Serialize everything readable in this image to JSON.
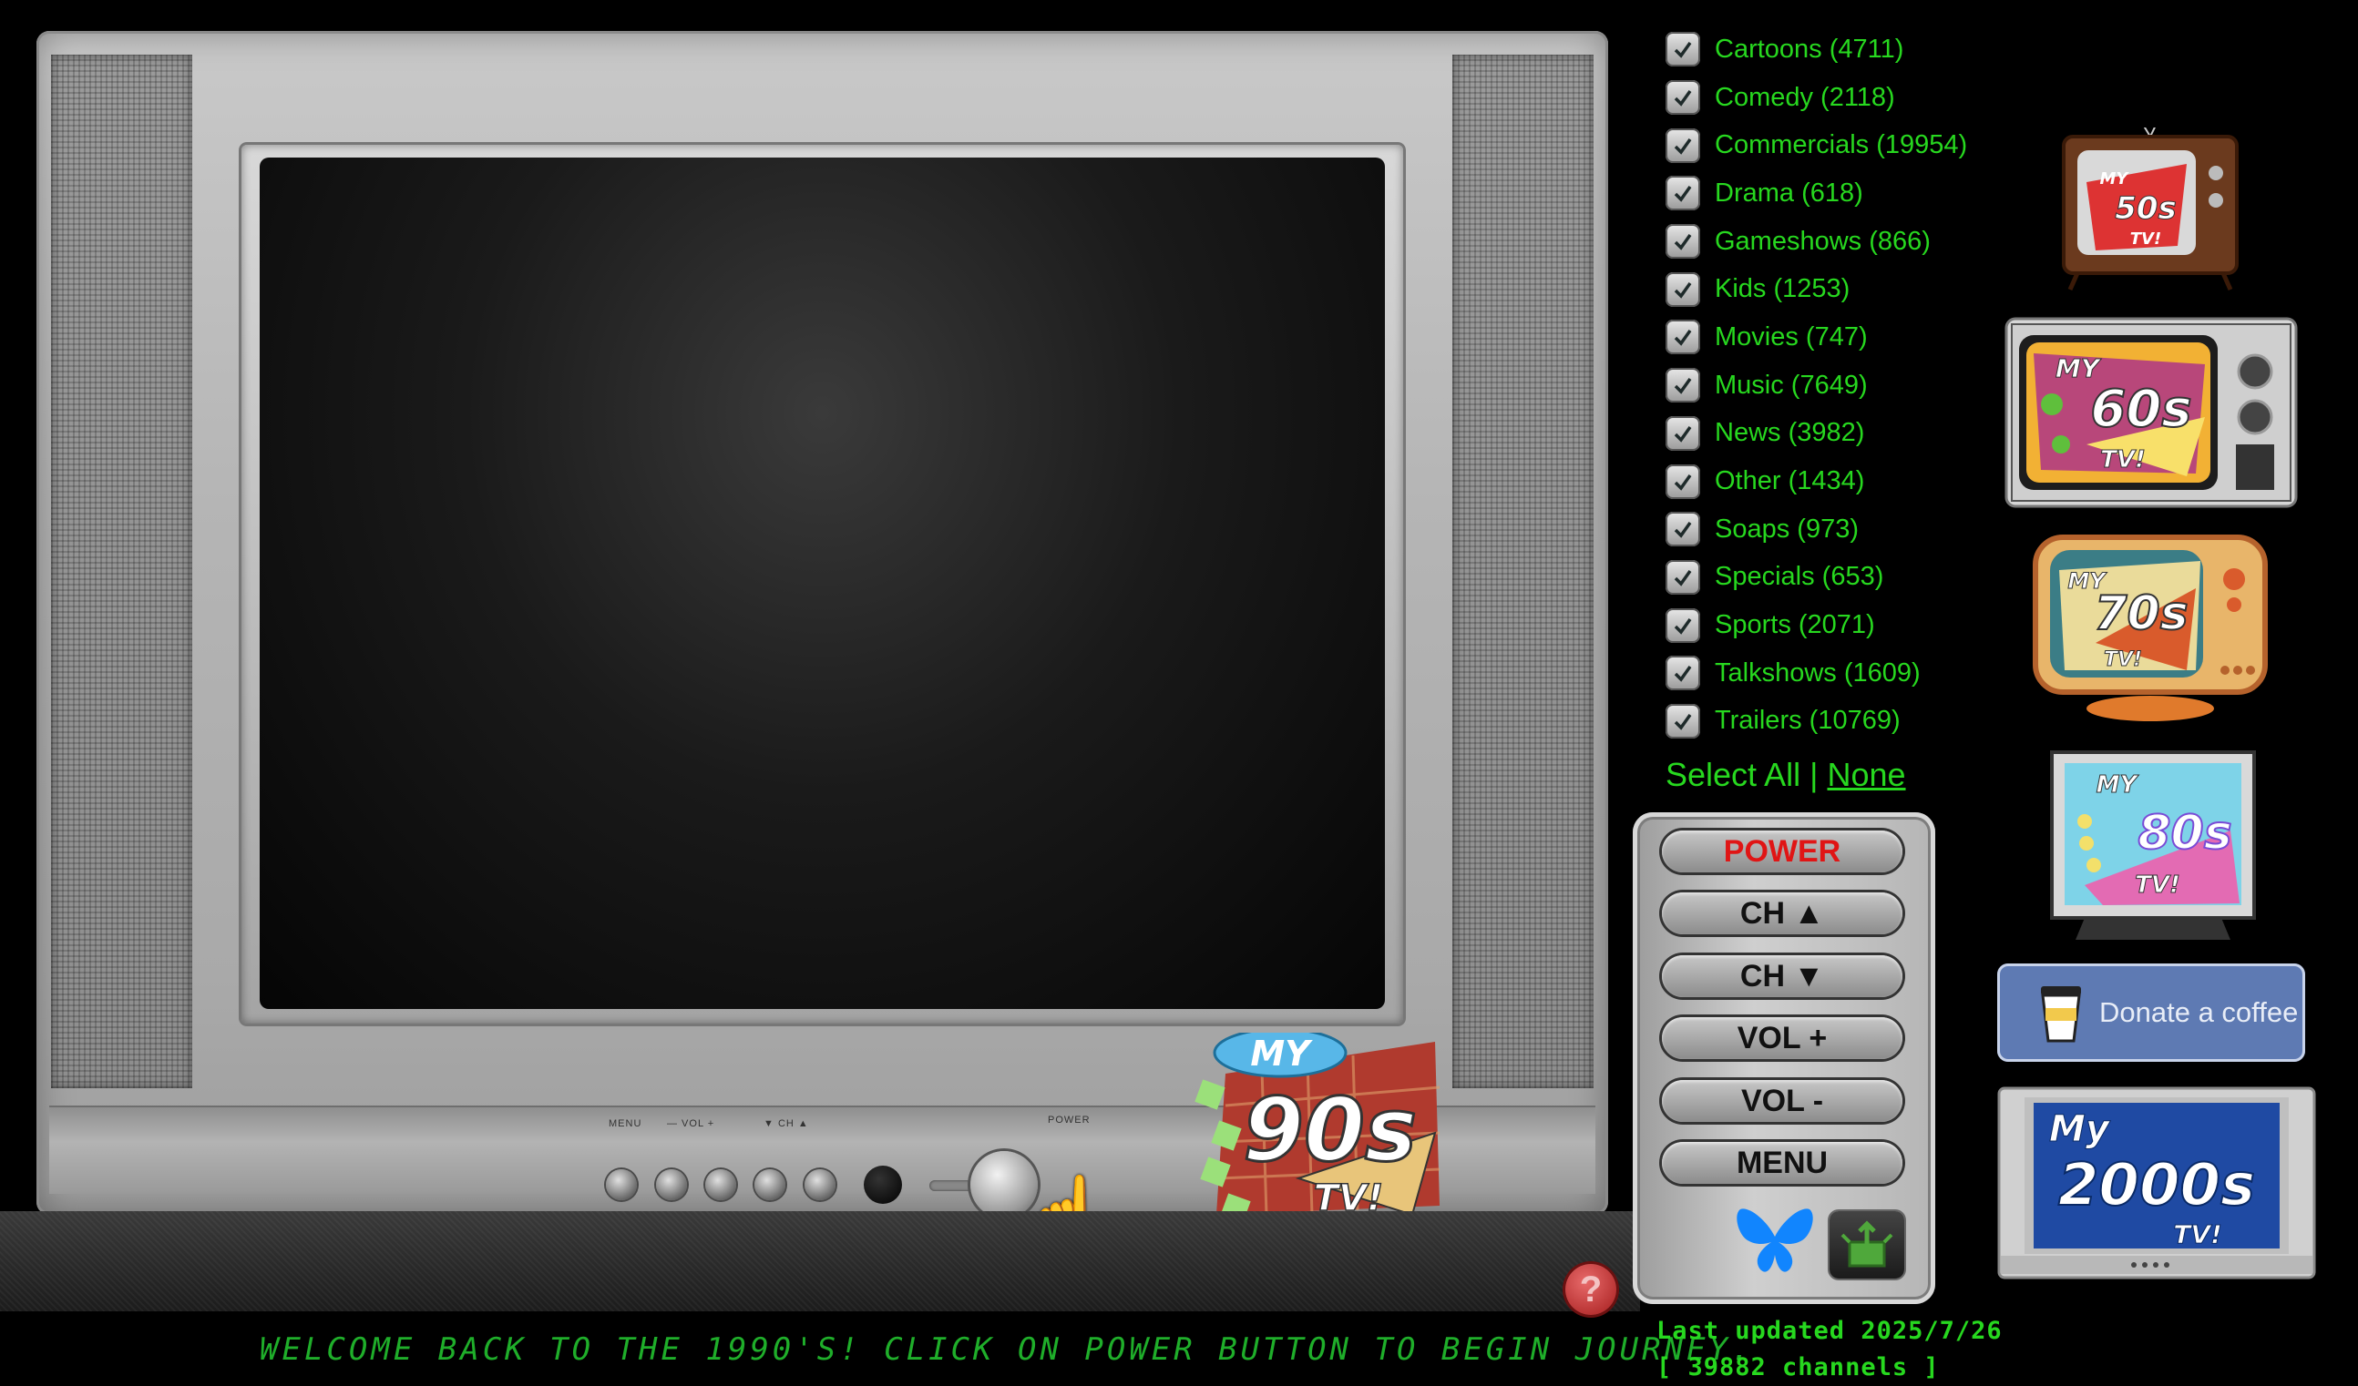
{
  "categories": [
    {
      "label": "Cartoons (4711)",
      "checked": true
    },
    {
      "label": "Comedy (2118)",
      "checked": true
    },
    {
      "label": "Commercials (19954)",
      "checked": true
    },
    {
      "label": "Drama (618)",
      "checked": true
    },
    {
      "label": "Gameshows (866)",
      "checked": true
    },
    {
      "label": "Kids (1253)",
      "checked": true
    },
    {
      "label": "Movies (747)",
      "checked": true
    },
    {
      "label": "Music (7649)",
      "checked": true
    },
    {
      "label": "News (3982)",
      "checked": true
    },
    {
      "label": "Other (1434)",
      "checked": true
    },
    {
      "label": "Soaps (973)",
      "checked": true
    },
    {
      "label": "Specials (653)",
      "checked": true
    },
    {
      "label": "Sports (2071)",
      "checked": true
    },
    {
      "label": "Talkshows (1609)",
      "checked": true
    },
    {
      "label": "Trailers (10769)",
      "checked": true
    }
  ],
  "select": {
    "all": "Select All",
    "separator": "|",
    "none": "None"
  },
  "remote": {
    "power": "POWER",
    "ch_up": "CH ▲",
    "ch_down": "CH ▼",
    "vol_up": "VOL +",
    "vol_down": "VOL -",
    "menu": "MENU"
  },
  "tv_controls": {
    "menu": "MENU",
    "vol": "— VOL +",
    "ch": "▼ CH ▲",
    "power": "POWER"
  },
  "status": {
    "last_updated": "Last updated 2025/7/26",
    "channels": "[ 39882 channels ]"
  },
  "welcome": "WELCOME BACK TO THE 1990'S! CLICK ON POWER BUTTON TO BEGIN JOURNEY.",
  "help": "?",
  "donate": "Donate a coffee",
  "logos": {
    "my": "MY",
    "tv": "TV!",
    "decade_90": "90s",
    "decade_50": "50s",
    "decade_60": "60s",
    "decade_70": "70s",
    "decade_80": "80s",
    "decade_2000": "2000s",
    "my_2000": "My"
  },
  "colors": {
    "text_green": "#27d81f",
    "ticker_green": "#1fae2a",
    "power_red": "#e01515",
    "donate_blue": "#5e7ab3",
    "bluesky_blue": "#1185fe"
  }
}
